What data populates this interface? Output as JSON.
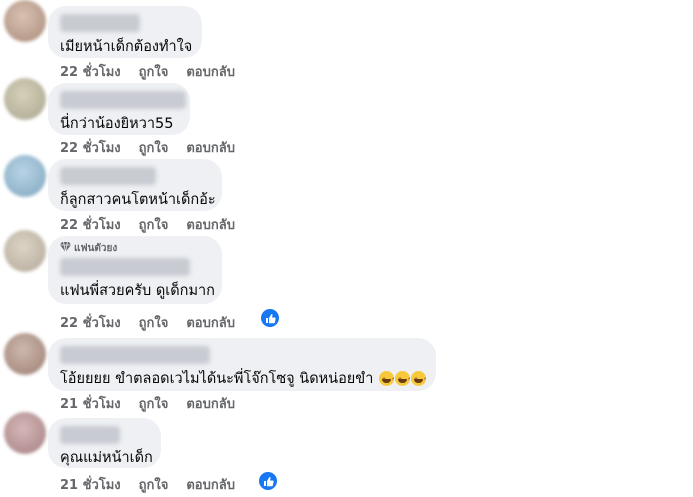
{
  "comments": [
    {
      "text": "เมียหน้าเด็กต้องทำใจ",
      "time": "22 ชั่วโมง",
      "like": "ถูกใจ",
      "reply": "ตอบกลับ"
    },
    {
      "text": "นี่กว่าน้องยิหวา55",
      "time": "22 ชั่วโมง",
      "like": "ถูกใจ",
      "reply": "ตอบกลับ"
    },
    {
      "text": "ก็ลูกสาวคนโตหน้าเด็กอ้ะ",
      "time": "22 ชั่วโมง",
      "like": "ถูกใจ",
      "reply": "ตอบกลับ"
    },
    {
      "fan_badge": "แฟนตัวยง",
      "text": "แฟนพี่สวยครับ ดูเด็กมาก",
      "time": "22 ชั่วโมง",
      "like": "ถูกใจ",
      "reply": "ตอบกลับ"
    },
    {
      "text": "โอ้ยยยย ขำตลอดเวไมได้นะพี่โจ๊กโซจู นิดหน่อยขำ",
      "time": "21 ชั่วโมง",
      "like": "ถูกใจ",
      "reply": "ตอบกลับ"
    },
    {
      "text": "คุณแม่หน้าเด็ก",
      "time": "21 ชั่วโมง",
      "like": "ถูกใจ",
      "reply": "ตอบกลับ"
    }
  ],
  "colors": {
    "bubble": "#eef0f3",
    "meta_text": "#65676b",
    "like_badge": "#1877f2"
  }
}
